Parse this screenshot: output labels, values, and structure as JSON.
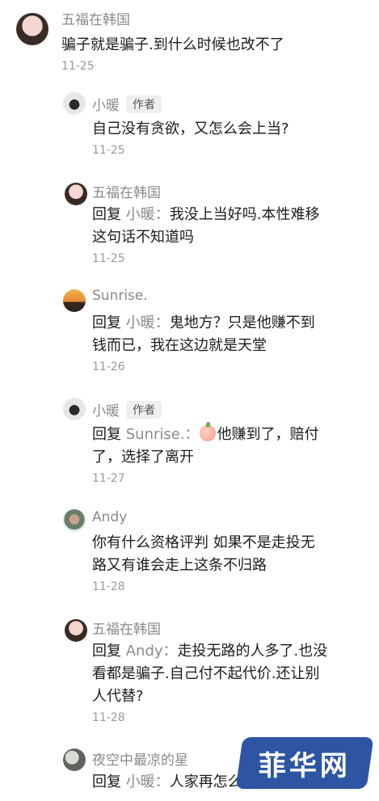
{
  "comments": [
    {
      "name": "五福在韩国",
      "text": "骗子就是骗子.到什么时候也改不了",
      "date": "11-25"
    },
    {
      "name": "小暖",
      "tag": "作者",
      "text": "自己没有贪欲，又怎么会上当?",
      "date": "11-25"
    },
    {
      "name": "五福在韩国",
      "reply_prefix": "回复 ",
      "reply_to": "小暖：",
      "text_line1": "我没上当好吗.本性难移",
      "text_line2": "这句话不知道吗",
      "date": "11-25"
    },
    {
      "name": "Sunrise.",
      "reply_prefix": "回复 ",
      "reply_to": "小暖：",
      "text_line1": "鬼地方？只是他赚不到",
      "text_line2": "钱而已，我在这边就是天堂",
      "date": "11-26"
    },
    {
      "name": "小暖",
      "tag": "作者",
      "reply_prefix": "回复 ",
      "reply_to": "Sunrise.：",
      "text_line1": "他赚到了，赔付",
      "text_line2": "了，选择了离开",
      "date": "11-27"
    },
    {
      "name": "Andy",
      "text_line1": "你有什么资格评判 如果不是走投无",
      "text_line2": "路又有谁会走上这条不归路",
      "date": "11-28"
    },
    {
      "name": "五福在韩国",
      "reply_prefix": "回复 ",
      "reply_to": "Andy：",
      "text_line1": "走投无路的人多了.也没",
      "text_line2": "看都是骗子.自己付不起代价.还让别",
      "text_line3": "人代替?",
      "date": "11-28"
    },
    {
      "name": "夜空中最凉的星",
      "reply_prefix": "回复 ",
      "reply_to": "小暖：",
      "text_line1": "人家再怎么",
      "date": ""
    }
  ],
  "watermark": "菲华网"
}
